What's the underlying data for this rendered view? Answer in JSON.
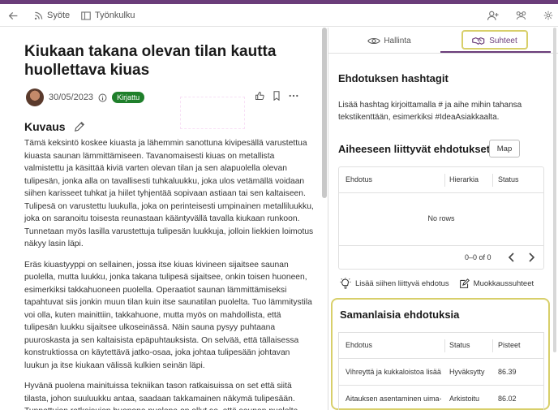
{
  "topbar": {
    "syote_label": "Syöte",
    "tyonkulku_label": "Työnkulku"
  },
  "idea": {
    "title": "Kiukaan takana olevan tilan kautta huollettava kiuas",
    "date": "30/05/2023",
    "status_badge": "Kirjattu",
    "description_heading": "Kuvaus",
    "paragraphs": [
      "Tämä keksintö koskee kiuasta ja lähemmin sanottuna kivipesällä varustettua kiuasta saunan lämmittämiseen. Tavanomaisesti kiuas on metallista valmistettu ja käsittää kiviä varten olevan tilan ja sen alapuolella olevan tulipesän, jonka alla on tavallisesti tuhkaluukku, joka ulos vetämällä voidaan siihen karisseet tuhkat ja hiilet tyhjentää sopivaan astiaan tai sen kaltaiseen. Tulipesä on varustettu luukulla, joka on perinteisesti umpinainen metalliluukku, joka on saranoitu toisesta reunastaan kääntyvällä tavalla kiukaan runkoon. Tunnetaan myös lasilla varustettuja tulipesän luukkuja, jolloin liekkien loimotus näkyy lasin läpi.",
      "Eräs kiuastyyppi on sellainen, jossa itse kiuas kivineen sijaitsee saunan puolella, mutta luukku, jonka takana tulipesä sijaitsee, onkin toisen huoneen, esimerkiksi takkahuoneen puolella. Operaatiot saunan lämmittämiseksi tapahtuvat siis jonkin muun tilan kuin itse saunatilan puolelta. Tuo lämmitystila voi olla, kuten mainittiin, takkahuone, mutta myös on mahdollista, että tulipesän luukku sijaitsee ulkoseinässä. Näin sauna pysyy puhtaana puuroskasta ja sen kaltaisista epäpuhtauksista. On selvää, että tällaisessa konstruktiossa on käytettävä jatko-osaa, joka johtaa tulipesään johtavan luukun ja itse kiukaan välissä kulkien seinän läpi.",
      "Hyvänä puolena mainituissa tekniikan tason ratkaisuissa on set että siitä tilasta, johon suuluukku antaa, saadaan takkamainen näkymä tulipesään. Tunnettujen ratkaisujen huonona puolena on ollut se, että saunan puolelta"
    ]
  },
  "tabs": {
    "hallinta": "Hallinta",
    "suhteet": "Suhteet"
  },
  "hashtags": {
    "title": "Ehdotuksen hashtagit",
    "description": "Lisää hashtag kirjoittamalla # ja aihe mihin tahansa tekstikenttään, esimerkiksi #IdeaAsiakkaalta."
  },
  "related": {
    "title": "Aiheeseen liittyvät ehdotukset",
    "map_button": "Map",
    "columns": [
      "Ehdotus",
      "Hierarkia",
      "Status"
    ],
    "empty_text": "No rows",
    "pagination": "0–0 of 0",
    "add_link": "Lisää siihen liittyvä ehdotus",
    "edit_link": "Muokkaussuhteet"
  },
  "similar": {
    "title": "Samanlaisia ehdotuksia",
    "columns": [
      "Ehdotus",
      "Status",
      "Pisteet"
    ],
    "rows": [
      {
        "ehdotus": "Vihreyttä ja kukkaloistoa lisää",
        "status": "Hyväksytty",
        "pisteet": "86.39"
      },
      {
        "ehdotus": "Aitauksen asentaminen uima-...",
        "status": "Arkistoitu",
        "pisteet": "86.02"
      }
    ]
  },
  "colors": {
    "accent": "#6b3d7a",
    "badge_green": "#1f7f2b",
    "highlight": "#d8cf6a"
  }
}
